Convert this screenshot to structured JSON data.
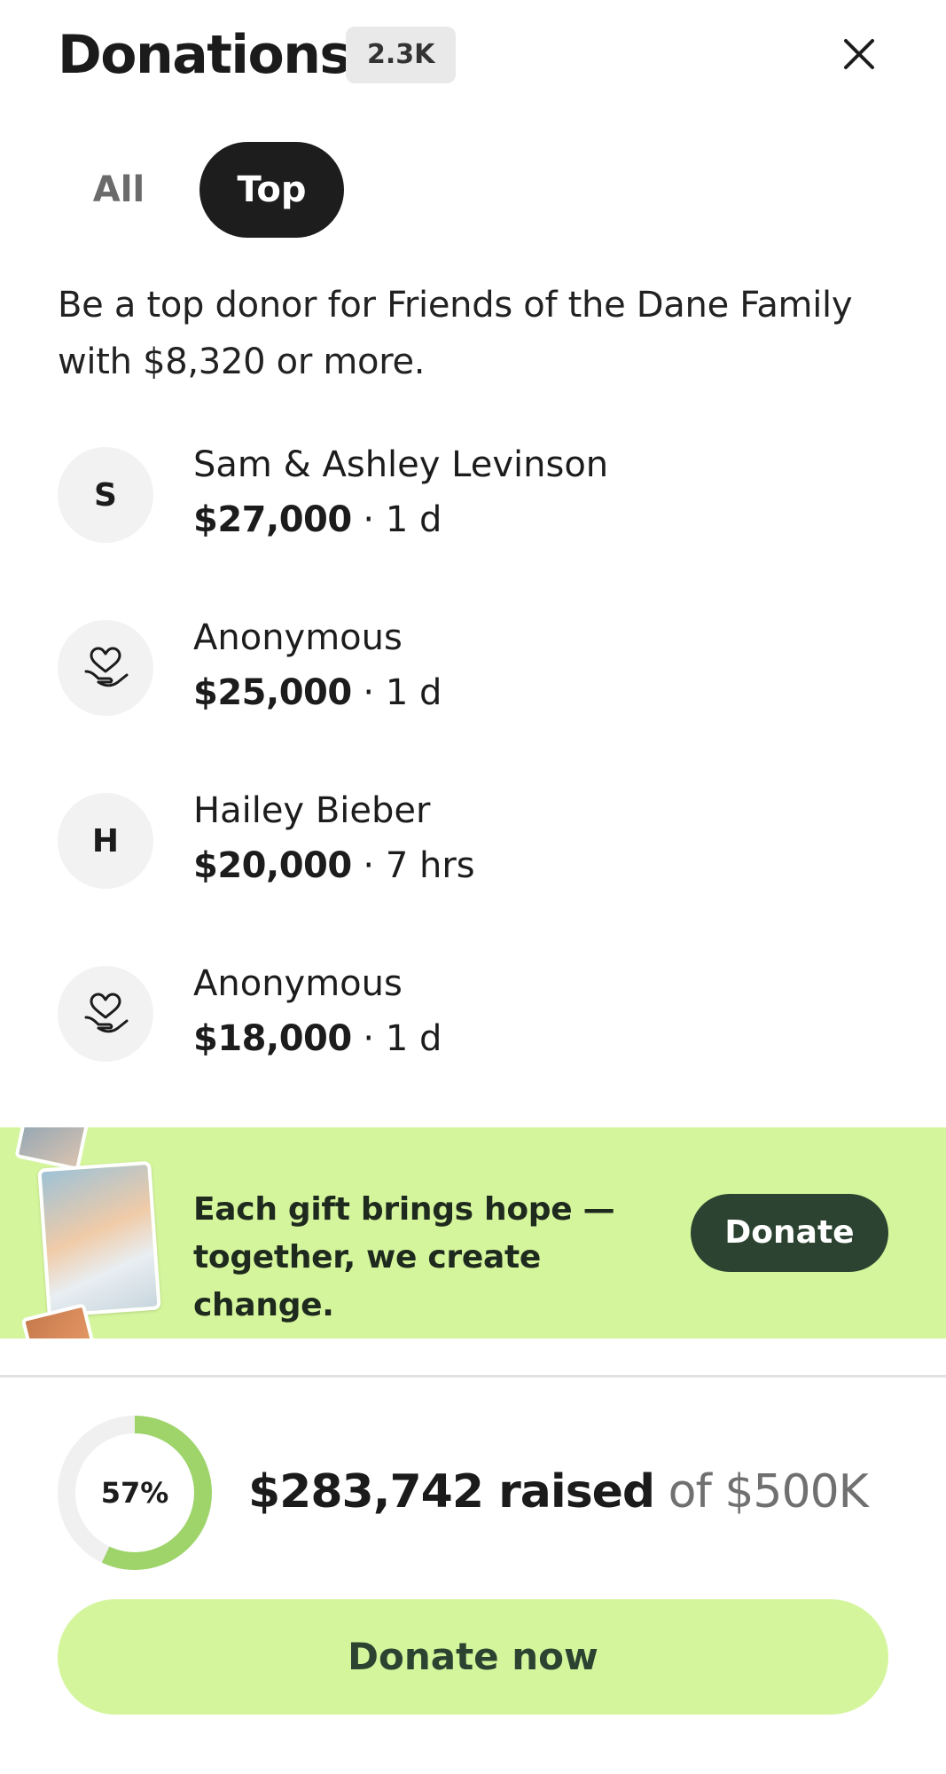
{
  "header": {
    "title": "Donations",
    "count_badge": "2.3K",
    "close_icon": "close-icon"
  },
  "tabs": [
    {
      "label": "All",
      "selected": false
    },
    {
      "label": "Top",
      "selected": true
    }
  ],
  "description": "Be a top donor for Friends of the Dane Family with $8,320 or more.",
  "donors": [
    {
      "initial": "S",
      "name": "Sam & Ashley Levinson",
      "amount": "$27,000",
      "time": "· 1 d",
      "icon": ""
    },
    {
      "initial": "",
      "name": "Anonymous",
      "amount": "$25,000",
      "time": "· 1 d",
      "icon": "heart-hand-icon"
    },
    {
      "initial": "H",
      "name": "Hailey Bieber",
      "amount": "$20,000",
      "time": "· 7 hrs",
      "icon": ""
    },
    {
      "initial": "",
      "name": "Anonymous",
      "amount": "$18,000",
      "time": "· 1 d",
      "icon": "heart-hand-icon"
    }
  ],
  "banner": {
    "message": "Each gift brings hope — together, we create change.",
    "button_label": "Donate"
  },
  "progress": {
    "percent_label": "57%",
    "fraction": 0.57,
    "raised_amount": "$283,742 raised",
    "goal_text": "of $500K"
  },
  "cta": {
    "label": "Donate now"
  },
  "colors": {
    "accent_light": "#d4f59c",
    "accent_dark": "#2c4331",
    "ring": "#9ed46a"
  }
}
